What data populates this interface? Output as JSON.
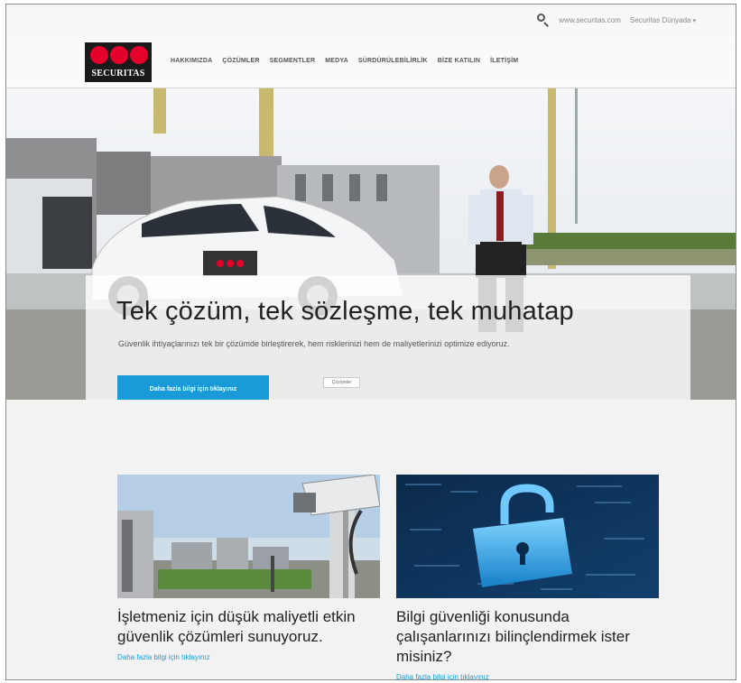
{
  "header": {
    "utility_links": [
      "www.securitas.com",
      "Securitas Dünyada"
    ],
    "logo_text": "SECURITAS",
    "nav": [
      "HAKKIMIZDA",
      "ÇÖZÜMLER",
      "SEGMENTLER",
      "MEDYA",
      "SÜRDÜRÜLEBİLİRLİK",
      "BİZE KATILIN",
      "İLETİŞİM"
    ]
  },
  "hero": {
    "title": "Tek çözüm, tek sözleşme, tek muhatap",
    "subtitle": "Güvenlik ihtiyaçlarınızı tek bir çözümde birleştirerek, hem risklerinizi hem de maliyetlerinizi optimize ediyoruz.",
    "cta_label": "Daha fazla bilgi için tıklayınız",
    "secondary_label": "Çözümler"
  },
  "cards": [
    {
      "title": "İşletmeniz için düşük maliyetli etkin güvenlik çözümleri sunuyoruz.",
      "link": "Daha fazla bilgi için tıklayınız"
    },
    {
      "title": "Bilgi güvenliği konusunda çalışanlarınızı bilinçlendirmek ister misiniz?",
      "link": "Daha fazla bilgi için tıklayınız"
    }
  ],
  "colors": {
    "accent": "#1a9bd7",
    "brand_red": "#e4002b",
    "logo_bg": "#1a1a1a"
  },
  "icons": [
    "search-icon"
  ]
}
